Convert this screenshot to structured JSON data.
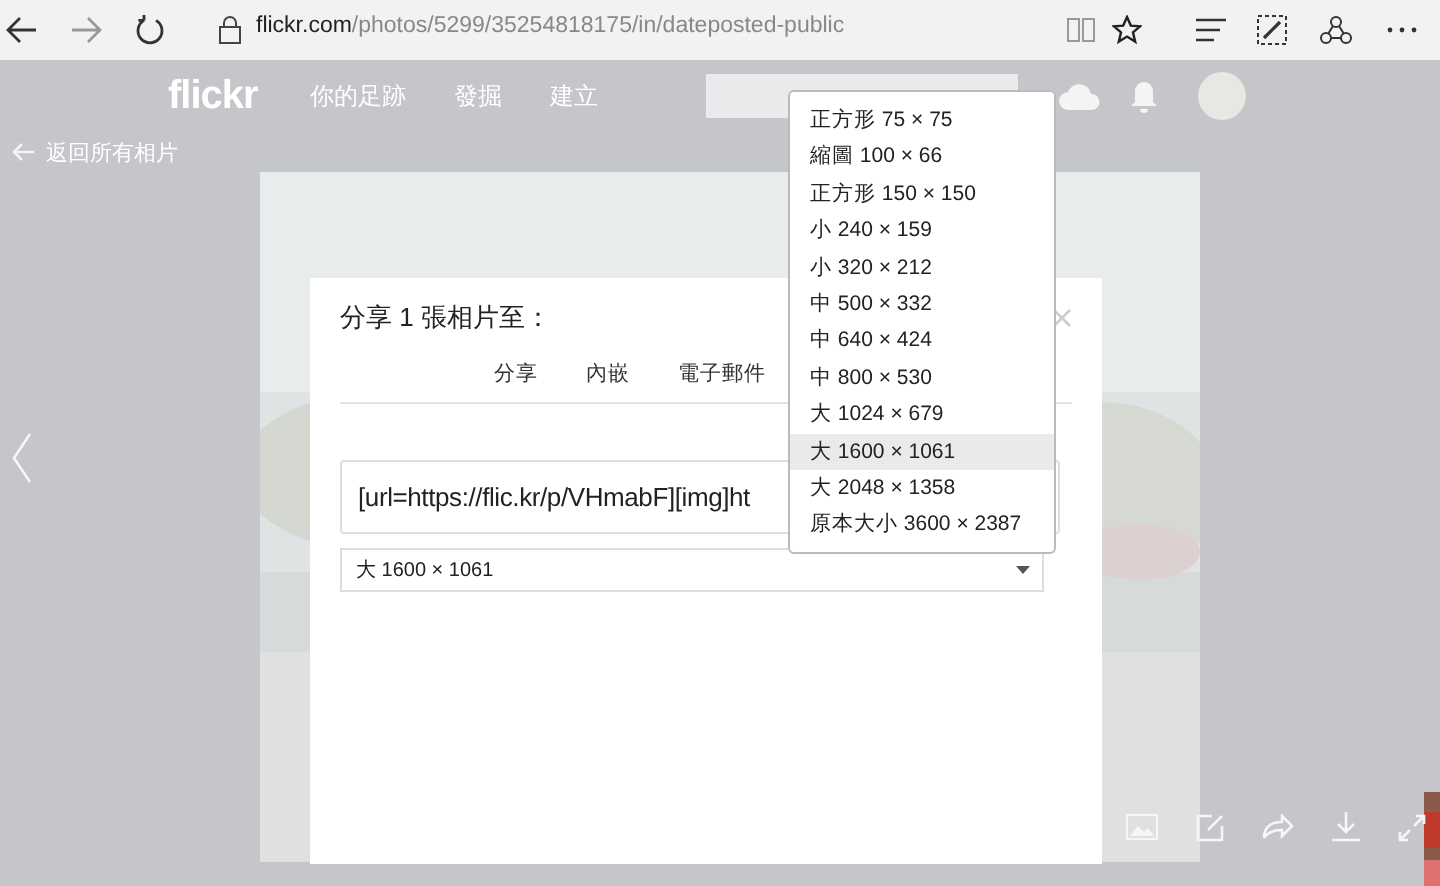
{
  "browser": {
    "url_host": "flickr.com",
    "url_path": "/photos/5299/35254818175/in/dateposted-public"
  },
  "site_nav": {
    "logo": "flickr",
    "links": [
      "你的足跡",
      "發掘",
      "建立"
    ]
  },
  "back_link": "返回所有相片",
  "share_dialog": {
    "title": "分享 1 張相片至：",
    "tabs": [
      "分享",
      "內嵌",
      "電子郵件"
    ],
    "code_field": {
      "value": "[url=https://flic.kr/p/VHmabF][img]ht"
    },
    "size_select": {
      "value": "大 1600 × 1061"
    }
  },
  "size_options": [
    {
      "label": "正方形 75 × 75",
      "selected": false
    },
    {
      "label": "縮圖 100 × 66",
      "selected": false
    },
    {
      "label": "正方形 150 × 150",
      "selected": false
    },
    {
      "label": "小 240 × 159",
      "selected": false
    },
    {
      "label": "小 320 × 212",
      "selected": false
    },
    {
      "label": "中 500 × 332",
      "selected": false
    },
    {
      "label": "中 640 × 424",
      "selected": false
    },
    {
      "label": "中 800 × 530",
      "selected": false
    },
    {
      "label": "大 1024 × 679",
      "selected": false
    },
    {
      "label": "大 1600 × 1061",
      "selected": true
    },
    {
      "label": "大 2048 × 1358",
      "selected": false
    },
    {
      "label": "原本大小 3600 × 2387",
      "selected": false
    }
  ]
}
